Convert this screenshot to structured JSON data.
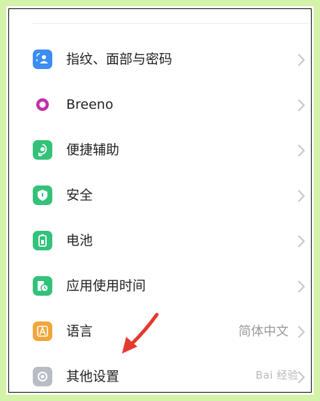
{
  "settings_list": {
    "items": [
      {
        "label": "指纹、面部与密码",
        "icon": "fingerprint-face-password-icon",
        "icon_color": "#3b8df2",
        "value": ""
      },
      {
        "label": "Breeno",
        "icon": "breeno-icon",
        "icon_color": "#c030a8",
        "value": ""
      },
      {
        "label": "便捷辅助",
        "icon": "convenience-assist-icon",
        "icon_color": "#33c27a",
        "value": ""
      },
      {
        "label": "安全",
        "icon": "security-shield-icon",
        "icon_color": "#33c27a",
        "value": ""
      },
      {
        "label": "电池",
        "icon": "battery-icon",
        "icon_color": "#33c27a",
        "value": ""
      },
      {
        "label": "应用使用时间",
        "icon": "app-usage-time-icon",
        "icon_color": "#33c27a",
        "value": ""
      },
      {
        "label": "语言",
        "icon": "language-icon",
        "icon_color": "#f2a63a",
        "value": "简体中文"
      },
      {
        "label": "其他设置",
        "icon": "other-settings-icon",
        "icon_color": "#b8bcc4",
        "value": ""
      }
    ]
  },
  "annotation": {
    "icon": "red-arrow-pointer-icon",
    "color": "#e53a2f"
  },
  "watermark": {
    "text": "Bai 经验"
  },
  "frame": {
    "outer_color": "#d3f3a8",
    "inner_color": "#000000"
  }
}
